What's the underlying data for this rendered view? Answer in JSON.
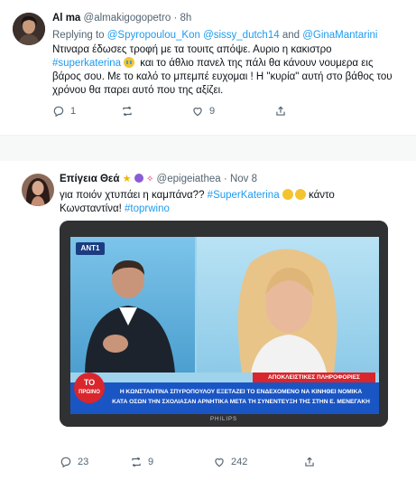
{
  "tweet1": {
    "name": "Al ma",
    "handle": "@almakigogopetro",
    "time": "8h",
    "replying_prefix": "Replying to",
    "reply_handle_1": "@Spyropoulou_Kon",
    "reply_handle_2": "@sissy_dutch14",
    "reply_and": "and",
    "reply_handle_3": "@GinaMantarini",
    "line1": "Ντιναρα έδωσες τροφή με τα τουιτς απόψε. Αυριο η κακιστρo",
    "hashtag": "#superkaterina",
    "line2_rest": "και το άθλιο πανελ της πάλι θα κάνουν νουμερα εις",
    "line3": "βάρος σου. Με το καλό το μπεμπέ ευχομαι ! Η \"κυρία\" αυτή στο βάθος του",
    "line4": "χρόνου θα παρει αυτό που της αξίζει.",
    "replies": "1",
    "retweets": "",
    "likes": "9"
  },
  "tweet2": {
    "name": "Επίγεια Θεά",
    "handle": "@epigeiathea",
    "time": "Nov 8",
    "line1": "για ποιόν χτυπάει η καμπάνα??",
    "hashtag1": "#SuperKaterina",
    "line1_end": "κάντο",
    "line2": "Κωνσταντίνα!",
    "hashtag2": "#toprwino",
    "replies": "23",
    "retweets": "9",
    "likes": "242",
    "media": {
      "channel_logo": "ANT1",
      "show_logo_top": "ΤΟ",
      "show_logo_bottom": "ΠΡΩΙΝΟ",
      "banner_tag": "ΑΠΟΚΛΕΙΣΤΙΚΕΣ ΠΛΗΡΟΦΟΡΙΕΣ",
      "caption_line1": "Η ΚΩΝΣΤΑΝΤΙΝΑ ΣΠΥΡΟΠΟΥΛΟΥ ΕΞΕΤΑΖΕΙ ΤΟ ΕΝΔΕΧΟΜΕΝΟ ΝΑ ΚΙΝΗΘΕΙ ΝΟΜΙΚΑ",
      "caption_line2": "ΚΑΤΑ ΟΣΩΝ ΤΗΝ ΣΧΟΛΙΑΣΑΝ ΑΡΝΗΤΙΚΑ ΜΕΤΑ ΤΗ ΣΥΝΕΝΤΕΥΞΗ ΤΗΣ ΣΤΗΝ Ε. ΜΕΝΕΓΑΚΗ",
      "tv_brand": "PHILIPS"
    }
  },
  "colors": {
    "link": "#1d9bf0",
    "muted": "#536471",
    "banner_blue": "#1a55c4",
    "show_logo_red": "#d9262d"
  }
}
